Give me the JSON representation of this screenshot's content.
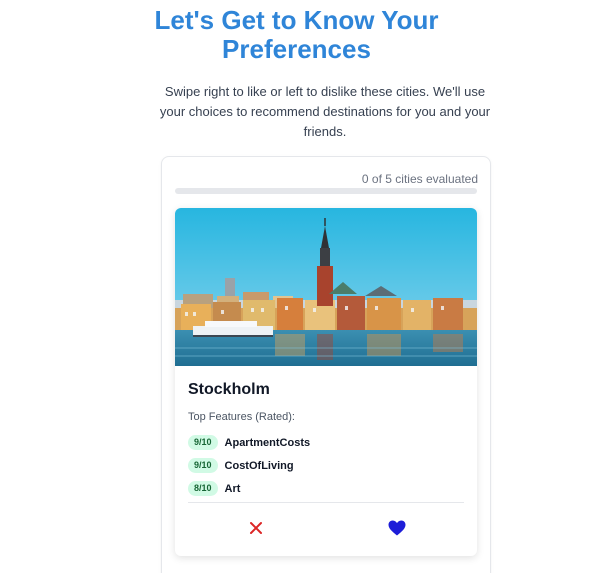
{
  "header": {
    "title_line1": "Let's Get to Know Your",
    "title_line2": "Preferences",
    "subtitle": "Swipe right to like or left to dislike these cities. We'll use your choices to recommend destinations for you and your friends."
  },
  "progress": {
    "text": "0 of 5 cities evaluated",
    "evaluated": 0,
    "total": 5
  },
  "city": {
    "name": "Stockholm",
    "image_alt": "Stockholm waterfront",
    "features_label": "Top Features (Rated):",
    "features": [
      {
        "score": "9/10",
        "name": "ApartmentCosts"
      },
      {
        "score": "9/10",
        "name": "CostOfLiving"
      },
      {
        "score": "8/10",
        "name": "Art"
      }
    ]
  },
  "actions": {
    "dislike_icon": "x-icon",
    "like_icon": "heart-icon",
    "dislike_color": "#dc2626",
    "like_color": "#1d1dd8"
  },
  "colors": {
    "accent": "#2f85d8",
    "badge_bg": "#d1fae5",
    "badge_text": "#166534"
  }
}
